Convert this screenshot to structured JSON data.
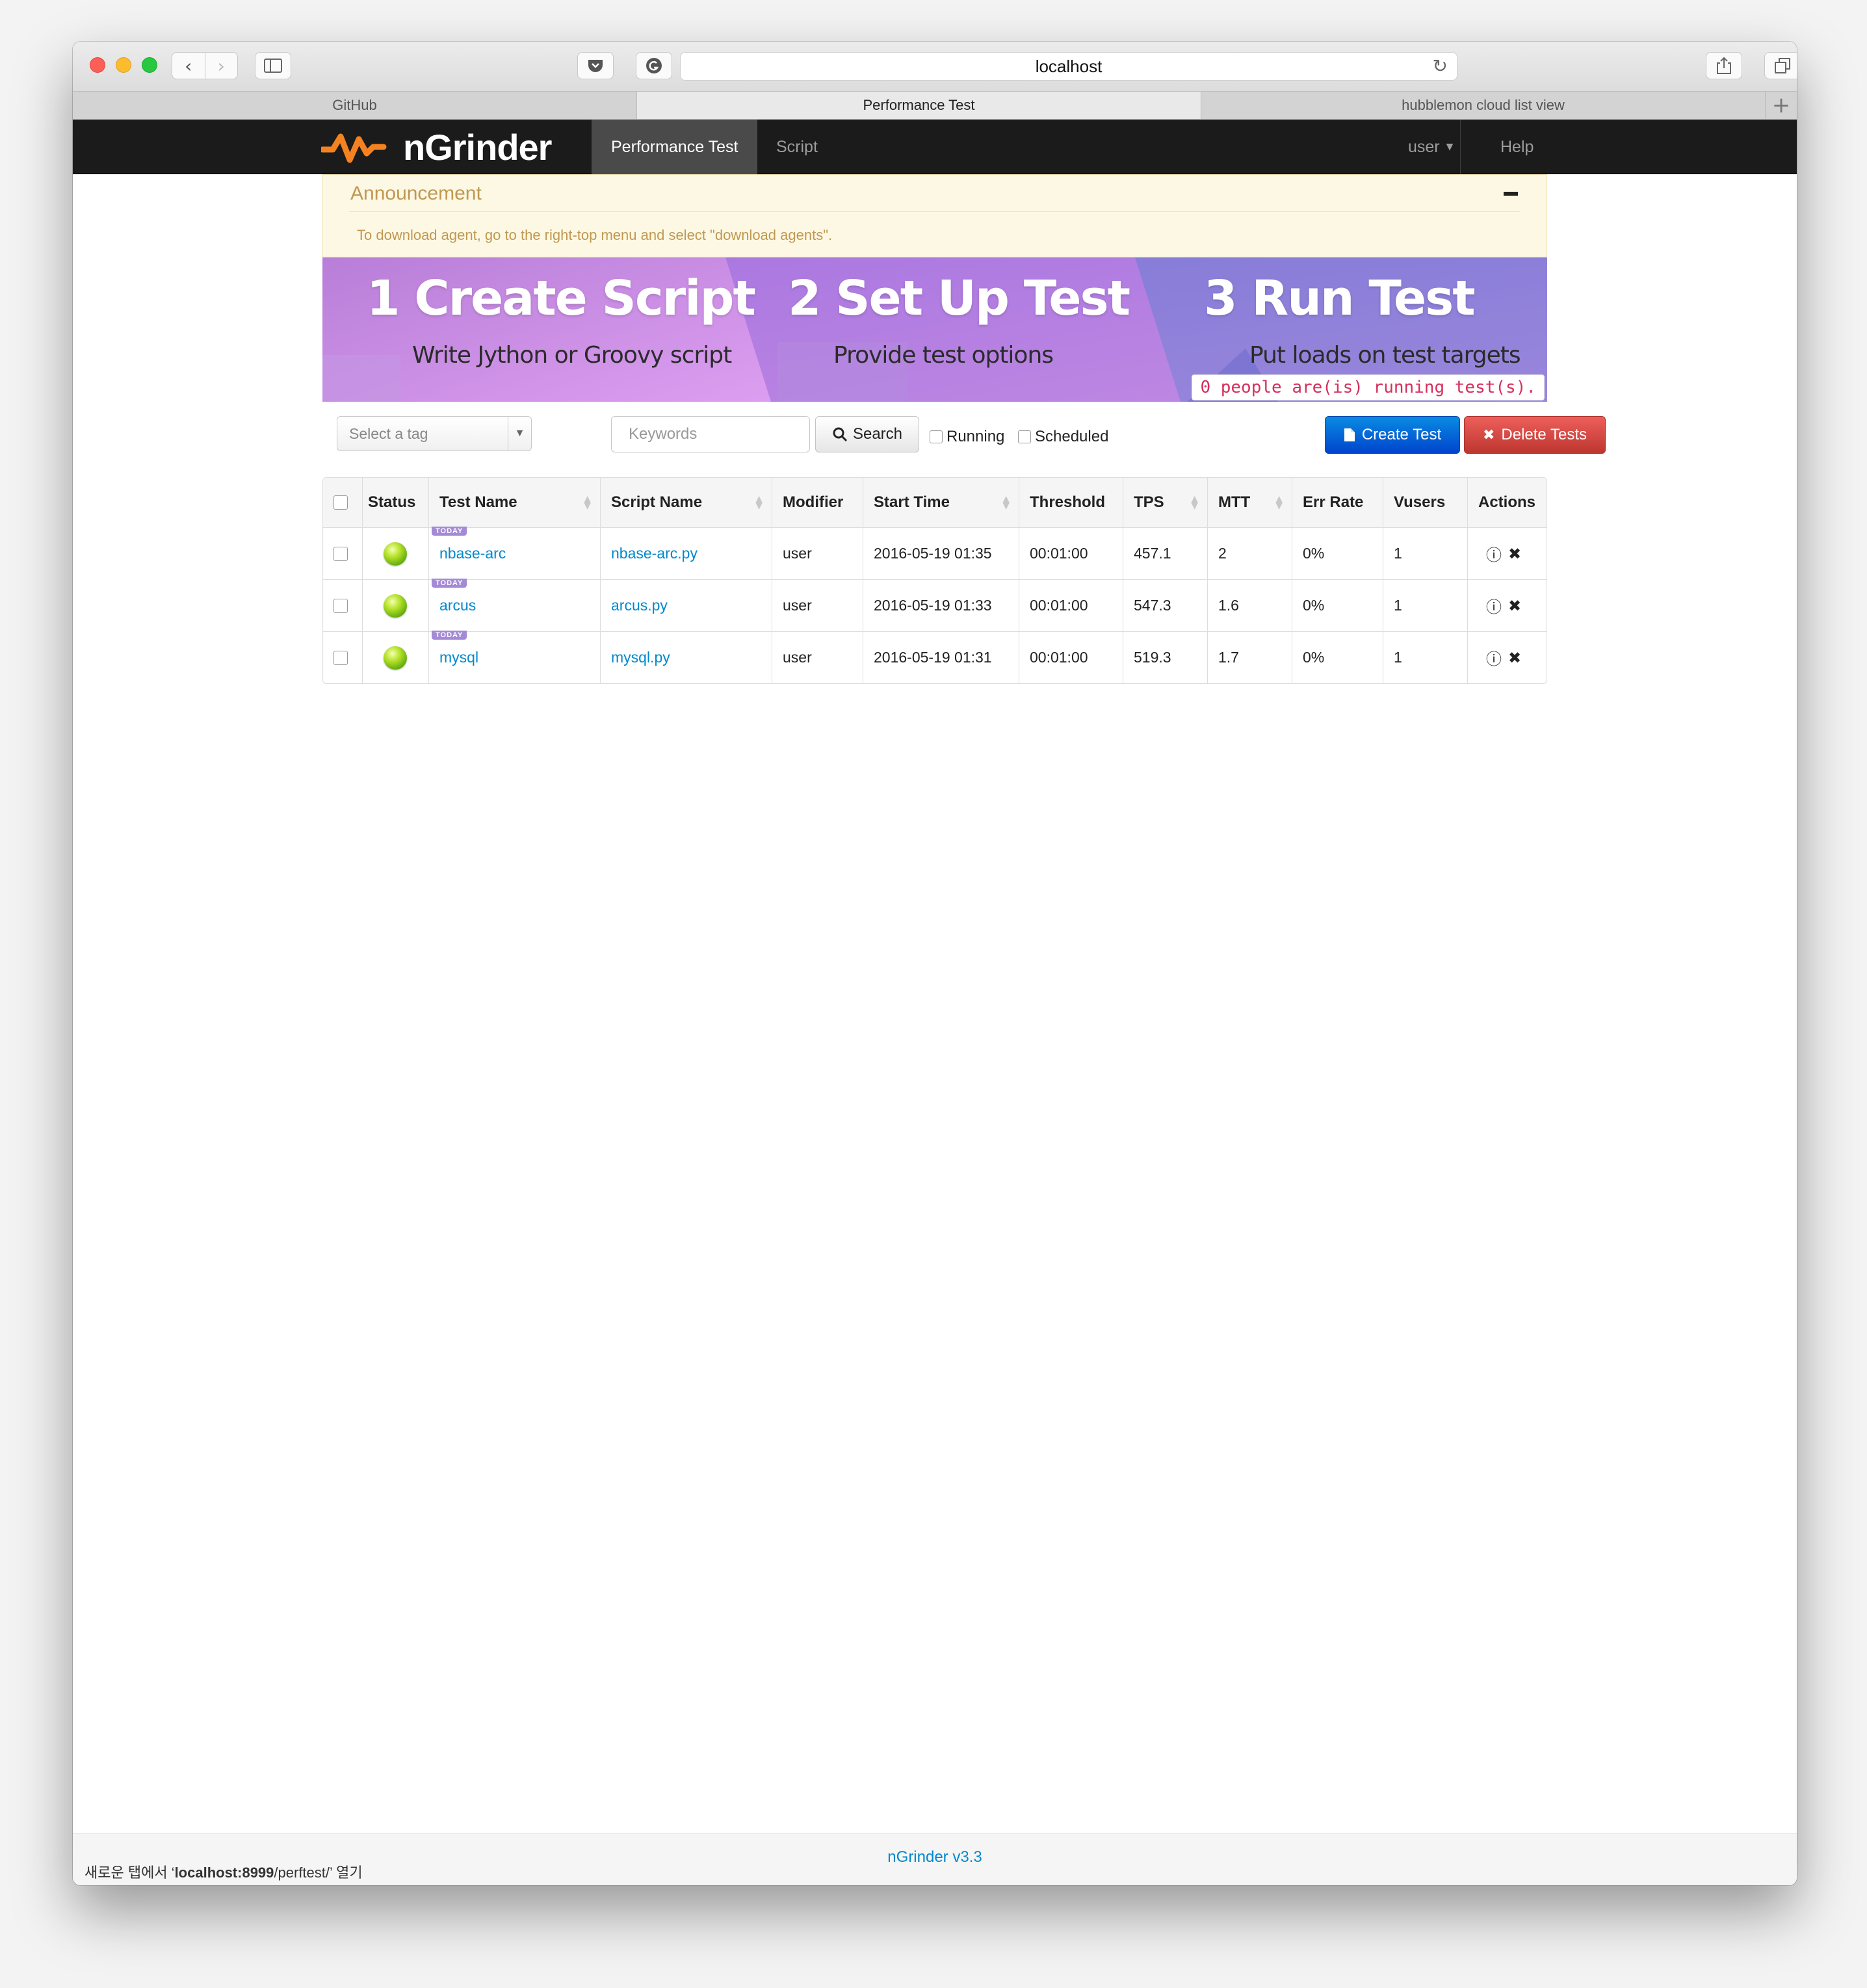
{
  "browser": {
    "url": "localhost",
    "tabs": [
      "GitHub",
      "Performance Test",
      "hubblemon cloud list view"
    ],
    "new_tab": "+"
  },
  "nav": {
    "logo": "nGrinder",
    "items": [
      "Performance Test",
      "Script"
    ],
    "user_menu": "user",
    "help": "Help"
  },
  "announcement": {
    "title": "Announcement",
    "text": "To download agent, go to the right-top menu and select \"download agents\"."
  },
  "banner": {
    "steps": [
      {
        "num": "1",
        "title": "Create Script",
        "sub": "Write Jython or Groovy script"
      },
      {
        "num": "2",
        "title": "Set Up Test",
        "sub": "Provide test options"
      },
      {
        "num": "3",
        "title": "Run Test",
        "sub": "Put loads on test targets"
      }
    ],
    "running_text": "0 people are(is) running test(s)."
  },
  "toolbar": {
    "tag_placeholder": "Select a tag",
    "keywords_placeholder": "Keywords",
    "search_label": "Search",
    "running_label": "Running",
    "scheduled_label": "Scheduled",
    "create_label": "Create Test",
    "delete_label": "Delete Tests"
  },
  "table": {
    "columns": [
      "Status",
      "Test Name",
      "Script Name",
      "Modifier",
      "Start Time",
      "Threshold",
      "TPS",
      "MTT",
      "Err Rate",
      "Vusers",
      "Actions"
    ],
    "badge": "TODAY",
    "rows": [
      {
        "test": "nbase-arc",
        "script": "nbase-arc.py",
        "modifier": "user",
        "start": "2016-05-19 01:35",
        "threshold": "00:01:00",
        "tps": "457.1",
        "mtt": "2",
        "err": "0%",
        "vusers": "1"
      },
      {
        "test": "arcus",
        "script": "arcus.py",
        "modifier": "user",
        "start": "2016-05-19 01:33",
        "threshold": "00:01:00",
        "tps": "547.3",
        "mtt": "1.6",
        "err": "0%",
        "vusers": "1"
      },
      {
        "test": "mysql",
        "script": "mysql.py",
        "modifier": "user",
        "start": "2016-05-19 01:31",
        "threshold": "00:01:00",
        "tps": "519.3",
        "mtt": "1.7",
        "err": "0%",
        "vusers": "1"
      }
    ]
  },
  "footer": {
    "version": "nGrinder v3.3",
    "status_prefix": "새로운 탭에서 ‘",
    "status_host": "localhost:8999",
    "status_path": "/perftest/’ 열기"
  },
  "colors": {
    "nav_bg": "#1b1b1b",
    "link": "#0088cc",
    "primary": "#0044cc",
    "danger": "#bd362f",
    "banner_purple": "#a070d8"
  }
}
